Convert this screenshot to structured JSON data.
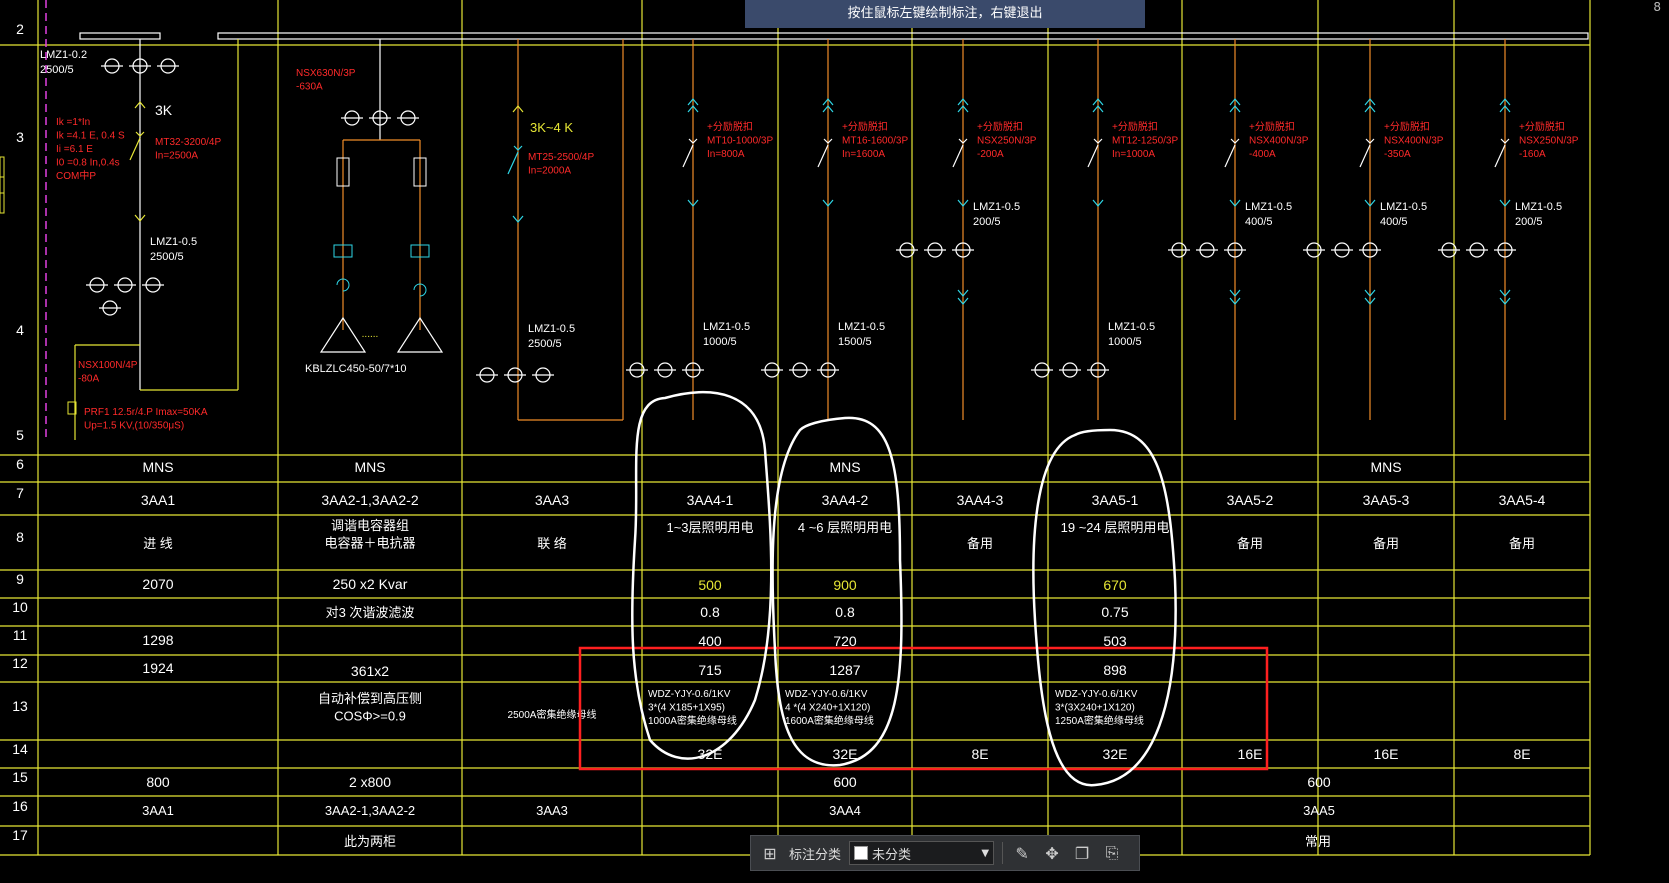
{
  "banner": "按住鼠标左键绘制标注，右键退出",
  "toolbar": {
    "label": "标注分类",
    "selected": "未分类"
  },
  "corner_mark": "8",
  "row_numbers": [
    "2",
    "3",
    "4",
    "5",
    "6",
    "7",
    "8",
    "9",
    "10",
    "11",
    "12",
    "13",
    "14",
    "15",
    "16",
    "17"
  ],
  "incomer": {
    "ct_top": "LMZ1-0.2\n2500/5",
    "k3": "3K",
    "protection": "Ik =1*In\nIk =4.1 E, 0.4 S\nIi =6.1 E\nI0  =0.8 In,0.4s\nCOM中P",
    "breaker": "MT32-3200/4P\nIn=2500A",
    "ct": "LMZ1-0.5\n2500/5",
    "aux_breaker": "NSX100N/4P\n-80A",
    "spd": "PRF1 12.5r/4.P   Imax=50KA\nUp=1.5 KV,(10/350μS)"
  },
  "capacitor": {
    "breaker": "NSX630N/3P\n-630A",
    "bank": "KBLZLC450-50/7*10"
  },
  "tie": {
    "k": "3K~4 K",
    "breaker": "MT25-2500/4P\nIn=2000A",
    "ct": "LMZ1-0.5\n2500/5"
  },
  "feeders": [
    {
      "br": "+分励脱扣\nMT10-1000/3P\nIn=800A",
      "ct": "LMZ1-0.5\n1000/5"
    },
    {
      "br": "+分励脱扣\nMT16-1600/3P\nIn=1600A",
      "ct": "LMZ1-0.5\n1500/5"
    },
    {
      "br": "+分励脱扣\nNSX250N/3P\n-200A",
      "ct": "LMZ1-0.5\n200/5"
    },
    {
      "br": "+分励脱扣\nMT12-1250/3P\nIn=1000A",
      "ct": "LMZ1-0.5\n1000/5"
    },
    {
      "br": "+分励脱扣\nNSX400N/3P\n-400A",
      "ct": "LMZ1-0.5\n400/5"
    },
    {
      "br": "+分励脱扣\nNSX400N/3P\n-350A",
      "ct": "LMZ1-0.5\n400/5"
    },
    {
      "br": "+分励脱扣\nNSX250N/3P\n-160A",
      "ct": "LMZ1-0.5\n200/5"
    }
  ],
  "table": {
    "r6": [
      "MNS",
      "MNS",
      "MNS",
      "MNS"
    ],
    "r7": [
      "3AA1",
      "3AA2-1,3AA2-2",
      "3AA3",
      "3AA4-1",
      "3AA4-2",
      "3AA4-3",
      "3AA5-1",
      "3AA5-2",
      "3AA5-3",
      "3AA5-4"
    ],
    "r8": [
      "进 线",
      "调谐电容器组\n电容器＋电抗器",
      "联 络",
      "1~3层照明用电",
      "4 ~6 层照明用电",
      "备用",
      "19 ~24 层照明用电",
      "备用",
      "备用",
      "备用"
    ],
    "r9": [
      "2070",
      "250 x2 Kvar",
      "500",
      "900",
      "670"
    ],
    "r10": [
      "对3 次谐波滤波",
      "0.8",
      "0.8",
      "0.75"
    ],
    "r11": [
      "1298",
      "400",
      "720",
      "503"
    ],
    "r12": [
      "1924",
      "361x2",
      "715",
      "1287",
      "898"
    ],
    "r13": [
      "自动补偿到高压侧\nCOSΦ>=0.9",
      "2500A密集绝缘母线",
      "WDZ-YJY-0.6/1KV\n3*(4 X185+1X95)\n1000A密集绝缘母线",
      "WDZ-YJY-0.6/1KV\n4 *(4 X240+1X120)\n1600A密集绝缘母线",
      "WDZ-YJY-0.6/1KV\n3*(3X240+1X120)\n1250A密集绝缘母线"
    ],
    "r14": [
      "32E",
      "32E",
      "8E",
      "32E",
      "16E",
      "16E",
      "8E"
    ],
    "r15": [
      "800",
      "2 x800",
      "600",
      "600"
    ],
    "r16": [
      "3AA1",
      "3AA2-1,3AA2-2",
      "3AA3",
      "3AA4",
      "3AA5"
    ],
    "r17": [
      "此为两柜",
      "常用"
    ]
  }
}
